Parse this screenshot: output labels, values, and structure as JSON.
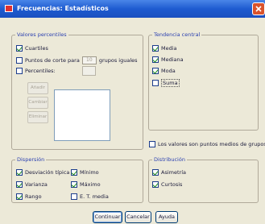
{
  "window": {
    "title": "Frecuencias: Estadísticos",
    "close_icon": "close-icon",
    "app_icon": "app-icon"
  },
  "percentile_values": {
    "legend": "Valores percentiles",
    "quartiles": {
      "label": "Cuartiles",
      "checked": true
    },
    "cut_points": {
      "label": "Puntos de corte para",
      "value": "10",
      "suffix": "grupos iguales",
      "checked": false
    },
    "percentiles": {
      "label": "Percentiles:",
      "checked": false,
      "value": ""
    },
    "buttons": {
      "add": "Añadir",
      "change": "Cambiar",
      "remove": "Eliminar"
    }
  },
  "central_tendency": {
    "legend": "Tendencia central",
    "mean": {
      "label": "Media",
      "checked": true
    },
    "median": {
      "label": "Mediana",
      "checked": true
    },
    "mode": {
      "label": "Moda",
      "checked": true
    },
    "sum": {
      "label": "Suma",
      "checked": false
    }
  },
  "midpoints": {
    "label": "Los valores son puntos medios de grupos",
    "checked": false
  },
  "dispersion": {
    "legend": "Dispersión",
    "std_dev": {
      "label": "Desviación típica",
      "checked": true
    },
    "variance": {
      "label": "Varianza",
      "checked": true
    },
    "range": {
      "label": "Rango",
      "checked": true
    },
    "minimum": {
      "label": "Mínimo",
      "checked": true
    },
    "maximum": {
      "label": "Máximo",
      "checked": true
    },
    "se_mean": {
      "label": "E. T. media",
      "checked": false
    }
  },
  "distribution": {
    "legend": "Distribución",
    "skewness": {
      "label": "Asimetría",
      "checked": true
    },
    "kurtosis": {
      "label": "Curtosis",
      "checked": true
    }
  },
  "buttons": {
    "continue": "Continuar",
    "cancel": "Cancelar",
    "help": "Ayuda"
  }
}
